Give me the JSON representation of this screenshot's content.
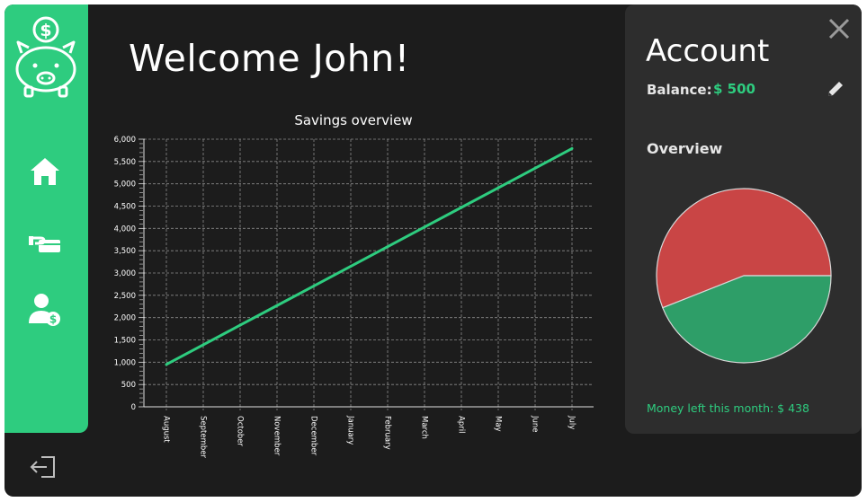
{
  "header": {
    "welcome": "Welcome John!"
  },
  "sidebar": {
    "logo": "piggy-bank-logo",
    "items": [
      {
        "icon": "home-icon"
      },
      {
        "icon": "transfer-icon"
      },
      {
        "icon": "user-money-icon"
      }
    ],
    "logout_icon": "logout-icon"
  },
  "account": {
    "title": "Account",
    "balance_label": "Balance:",
    "balance_value": "$ 500",
    "overview_label": "Overview",
    "money_left": "Money left this month: $ 438"
  },
  "colors": {
    "accent": "#2ecc7f",
    "pie_red": "#c94545",
    "pie_green": "#2e9e68",
    "bg": "#1c1c1c",
    "panel": "#2d2d2d"
  },
  "chart_data": [
    {
      "type": "line",
      "title": "Savings overview",
      "categories": [
        "August",
        "September",
        "October",
        "November",
        "December",
        "January",
        "February",
        "March",
        "April",
        "May",
        "June",
        "July"
      ],
      "series": [
        {
          "values": [
            950,
            1390,
            1830,
            2270,
            2710,
            3150,
            3590,
            4030,
            4470,
            4910,
            5350,
            5790
          ]
        }
      ],
      "ylim": [
        0,
        6000
      ],
      "yticks": [
        "0",
        "500",
        "1,000",
        "1,500",
        "2,000",
        "2,500",
        "3,000",
        "3,500",
        "4,000",
        "4,500",
        "5,000",
        "5,500",
        "6,000"
      ],
      "grid": true
    },
    {
      "type": "pie",
      "slices": [
        {
          "value": 56
        },
        {
          "value": 44
        }
      ]
    }
  ]
}
